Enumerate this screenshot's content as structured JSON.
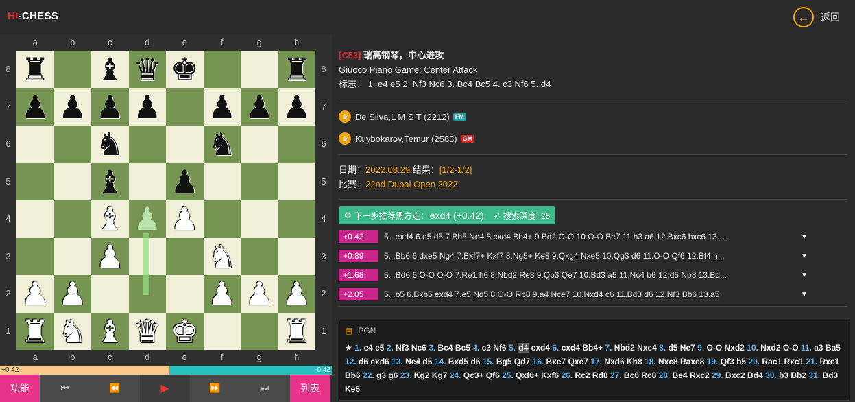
{
  "brand": {
    "hi": "HI",
    "chess": "-CHESS"
  },
  "back_label": "返回",
  "back_icon": "←",
  "files": [
    "a",
    "b",
    "c",
    "d",
    "e",
    "f",
    "g",
    "h"
  ],
  "ranks": [
    "8",
    "7",
    "6",
    "5",
    "4",
    "3",
    "2",
    "1"
  ],
  "board": [
    [
      "br",
      "",
      "bb",
      "bq",
      "bk",
      "",
      "",
      "br"
    ],
    [
      "bp",
      "bp",
      "bp",
      "bp",
      "",
      "bp",
      "bp",
      "bp"
    ],
    [
      "",
      "",
      "bn",
      "",
      "",
      "bn",
      "",
      ""
    ],
    [
      "",
      "",
      "bb",
      "",
      "bp",
      "",
      "",
      ""
    ],
    [
      "",
      "",
      "wb",
      "gp",
      "wp",
      "",
      "",
      ""
    ],
    [
      "",
      "",
      "wp",
      "",
      "",
      "wn",
      "",
      ""
    ],
    [
      "wp",
      "wp",
      "",
      "",
      "",
      "wp",
      "wp",
      "wp"
    ],
    [
      "wr",
      "wn",
      "wb",
      "wq",
      "wk",
      "",
      "",
      "wr"
    ]
  ],
  "eval": {
    "left": "+0.42",
    "right": "-0.42",
    "white_share": 0.51
  },
  "controls": {
    "func": "功能",
    "list": "列表",
    "first": "⏮",
    "prev": "⏪",
    "play": "▶",
    "next": "⏩",
    "last": "⏭"
  },
  "opening": {
    "eco": "[C53]",
    "cn_name": "瑞高钢琴，中心进攻",
    "en_name": "Giuoco Piano Game: Center Attack",
    "tag_label": "标志：",
    "tag_moves": "1. e4 e5 2. Nf3 Nc6 3. Bc4 Bc5 4. c3 Nf6 5. d4"
  },
  "players": [
    {
      "name": "De Silva,L M S T (2212)",
      "title": "FM"
    },
    {
      "name": "Kuybokarov,Temur (2583)",
      "title": "GM"
    }
  ],
  "info": {
    "date_label": "日期：",
    "date": "2022.08.29",
    "result_label": "结果：",
    "result": "[1/2-1/2]",
    "event_label": "比赛：",
    "event": "22nd Dubai Open 2022"
  },
  "engine": {
    "label": "下一步推荐黑方走：",
    "move": "exd4 (+0.42)",
    "depth_label": "搜索深度=25"
  },
  "variations": [
    {
      "eval": "+0.42",
      "moves": "5...exd4 6.e5 d5 7.Bb5 Ne4 8.cxd4 Bb4+ 9.Bd2 O-O 10.O-O Be7 11.h3 a6 12.Bxc6 bxc6 13...."
    },
    {
      "eval": "+0.89",
      "moves": "5...Bb6 6.dxe5 Ng4 7.Bxf7+ Kxf7 8.Ng5+ Ke8 9.Qxg4 Nxe5 10.Qg3 d6 11.O-O Qf6 12.Bf4 h..."
    },
    {
      "eval": "+1.68",
      "moves": "5...Bd6 6.O-O O-O 7.Re1 h6 8.Nbd2 Re8 9.Qb3 Qe7 10.Bd3 a5 11.Nc4 b6 12.d5 Nb8 13.Bd..."
    },
    {
      "eval": "+2.05",
      "moves": "5...b5 6.Bxb5 exd4 7.e5 Nd5 8.O-O Rb8 9.a4 Nce7 10.Nxd4 c6 11.Bd3 d6 12.Nf3 Bb6 13.a5"
    }
  ],
  "pgn_title": "PGN",
  "pgn": [
    [
      "★ ",
      ""
    ],
    [
      "1.",
      " e4 e5 "
    ],
    [
      "2.",
      " Nf3 Nc6 "
    ],
    [
      "3.",
      " Bc4 Bc5 "
    ],
    [
      "4.",
      " c3 Nf6 "
    ],
    [
      "5.",
      " "
    ],
    [
      "",
      "d4",
      "cur"
    ],
    [
      "",
      " exd4 "
    ],
    [
      "6.",
      " cxd4 Bb4+ "
    ],
    [
      "7.",
      " Nbd2 Nxe4 "
    ],
    [
      "8.",
      " d5 Ne7 "
    ],
    [
      "9.",
      " O-O Nxd2 "
    ],
    [
      "10.",
      " Nxd2 O-O "
    ],
    [
      "11.",
      " a3 Ba5 "
    ],
    [
      "12.",
      " d6 cxd6 "
    ],
    [
      "13.",
      " Ne4 d5 "
    ],
    [
      "14.",
      " Bxd5 d6 "
    ],
    [
      "15.",
      " Bg5 Qd7 "
    ],
    [
      "16.",
      " Bxe7 Qxe7 "
    ],
    [
      "17.",
      " Nxd6 Kh8 "
    ],
    [
      "18.",
      " Nxc8 Raxc8 "
    ],
    [
      "19.",
      " Qf3 b5 "
    ],
    [
      "20.",
      " Rac1 Rxc1 "
    ],
    [
      "21.",
      " Rxc1 Bb6 "
    ],
    [
      "22.",
      " g3 g6 "
    ],
    [
      "23.",
      " Kg2 Kg7 "
    ],
    [
      "24.",
      " Qc3+ Qf6 "
    ],
    [
      "25.",
      " Qxf6+ Kxf6 "
    ],
    [
      "26.",
      " Rc2 Rd8 "
    ],
    [
      "27.",
      " Bc6 Rc8 "
    ],
    [
      "28.",
      " Be4 Rxc2 "
    ],
    [
      "29.",
      " Bxc2 Bd4 "
    ],
    [
      "30.",
      " b3 Bb2 "
    ],
    [
      "31.",
      " Bd3 Ke5"
    ]
  ]
}
